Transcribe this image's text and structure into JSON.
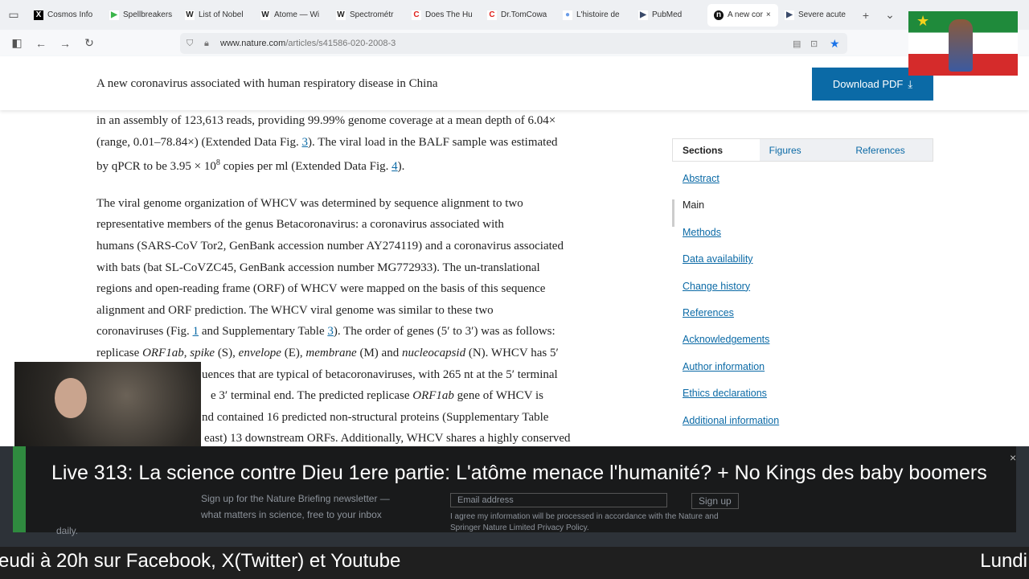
{
  "browser": {
    "tabs": [
      {
        "label": "Cosmos Info",
        "icon": "x-logo"
      },
      {
        "label": "Spellbreakers",
        "icon": "play-logo"
      },
      {
        "label": "List of Nobel",
        "icon": "wikipedia-logo"
      },
      {
        "label": "Atome — Wi",
        "icon": "wikipedia-logo"
      },
      {
        "label": "Spectrométr",
        "icon": "wikipedia-logo"
      },
      {
        "label": "Does The Hu",
        "icon": "c-logo"
      },
      {
        "label": "Dr.TomCowa",
        "icon": "c-logo"
      },
      {
        "label": "L'histoire de",
        "icon": "globe-logo"
      },
      {
        "label": "PubMed",
        "icon": "pubmed-logo"
      },
      {
        "label": "A new cor",
        "icon": "nature-logo",
        "active": true
      },
      {
        "label": "Severe acute",
        "icon": "pubmed-logo"
      }
    ],
    "url_domain": "www.nature.com",
    "url_path": "/articles/s41586-020-2008-3"
  },
  "header": {
    "title": "A new coronavirus associated with human respiratory disease in China",
    "download": "Download PDF"
  },
  "article": {
    "p1": [
      "in an assembly of 123,613 reads, providing 99.99% genome coverage at a mean depth of 6.04×",
      "(range, 0.01–78.84×) (Extended Data Fig. ",
      "3",
      "). The viral load in the BALF sample was estimated",
      "by qPCR to be 3.95 × 10",
      "8",
      " copies per ml (Extended Data Fig. ",
      "4",
      "). "
    ],
    "p2": [
      "The viral genome organization of WHCV was determined by sequence alignment to two",
      "representative members of the genus Betacoronavirus: a coronavirus associated with",
      "humans (SARS-CoV Tor2, GenBank accession number AY274119) and a coronavirus associated",
      "with bats (bat SL-CoVZC45, GenBank accession number MG772933). The un-translational",
      "regions and open-reading frame (ORF) of WHCV were mapped on the basis of this sequence",
      "alignment and ORF prediction. The WHCV viral genome was similar to these two",
      "coronaviruses (Fig. ",
      "1",
      " and Supplementary Table ",
      "3",
      "). The order of genes (5′ to 3′) was as follows:",
      "replicase ",
      "ORF1ab",
      ", ",
      "spike",
      " (S), ",
      "envelope",
      " (E), ",
      "membrane",
      " (M) and ",
      "nucleocapsid",
      " (N). WHCV has 5′",
      "uences that are typical of betacoronaviruses, with 265 nt at the 5′ terminal",
      "e 3′ terminal end. The predicted replicase ",
      "ORF1ab",
      " gene of WHCV is",
      "nd contained 16 predicted non-structural proteins (Supplementary Table",
      "east) 13 downstream ORFs. Additionally, WHCV shares a highly conserved"
    ]
  },
  "sidebar": {
    "tabs": [
      "Sections",
      "Figures",
      "References"
    ],
    "items": [
      "Abstract",
      "Main",
      "Methods",
      "Data availability",
      "Change history",
      "References",
      "Acknowledgements",
      "Author information",
      "Ethics declarations",
      "Additional information"
    ]
  },
  "newsletter": {
    "text1": "Sign up for the Nature Briefing newsletter —",
    "text2": "what matters in science, free to your inbox",
    "text3": "daily.",
    "placeholder": "Email address",
    "signup": "Sign up",
    "consent": "I agree my information will be processed in accordance with the Nature and",
    "consent2": "Springer Nature Limited Privacy Policy."
  },
  "overlay": {
    "title": "Live 313: La science contre Dieu 1ere partie: L'atôme menace l'humanité? + No Kings des baby boomers",
    "ticker_left": "eudi à 20h sur Facebook, X(Twitter) et Youtube",
    "ticker_right": "Lundi"
  }
}
